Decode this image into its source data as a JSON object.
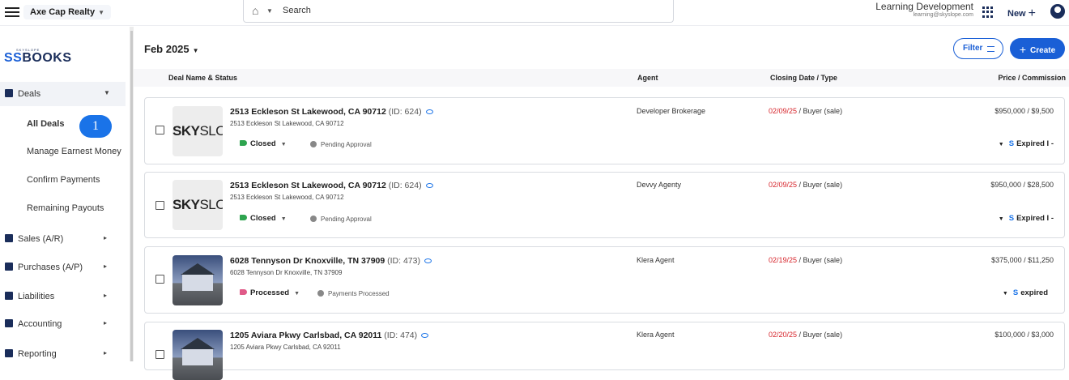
{
  "topbar": {
    "org_name": "Axe Cap Realty",
    "search_placeholder": "Search",
    "user_name": "Learning Development",
    "user_email": "learning@skyslope.com",
    "new_label": "New"
  },
  "sidebar": {
    "logo_small": "SKYSLOPE",
    "logo_text": "BOOKS",
    "deals_label": "Deals",
    "sub_items": [
      "All Deals",
      "Manage Earnest Money",
      "Confirm Payments",
      "Remaining Payouts"
    ],
    "badge": "1",
    "items": [
      "Sales (A/R)",
      "Purchases (A/P)",
      "Liabilities",
      "Accounting",
      "Reporting"
    ]
  },
  "main": {
    "period": "Feb 2025",
    "filter_label": "Filter",
    "create_label": "Create",
    "columns": [
      "Deal Name & Status",
      "Agent",
      "Closing Date / Type",
      "Price / Commission"
    ]
  },
  "deals": [
    {
      "title": "2513 Eckleson St Lakewood, CA 90712",
      "id": "(ID: 624)",
      "address": "2513 Eckleson St Lakewood, CA 90712",
      "thumb_bold": "SKY",
      "thumb_rest": "SLOI",
      "status": "Closed",
      "status_color": "#2ea44f",
      "sub_status": "Pending Approval",
      "agent": "Developer Brokerage",
      "closing_date": "02/09/25",
      "closing_type": " / Buyer (sale)",
      "price": "$950,000 / $9,500",
      "expired": "Expired I -"
    },
    {
      "title": "2513 Eckleson St Lakewood, CA 90712",
      "id": "(ID: 624)",
      "address": "2513 Eckleson St Lakewood, CA 90712",
      "thumb_bold": "SKY",
      "thumb_rest": "SLOI",
      "status": "Closed",
      "status_color": "#2ea44f",
      "sub_status": "Pending Approval",
      "agent": "Devvy Agenty",
      "closing_date": "02/09/25",
      "closing_type": " / Buyer (sale)",
      "price": "$950,000 / $28,500",
      "expired": "Expired I -"
    },
    {
      "title": "6028 Tennyson Dr Knoxville, TN 37909",
      "id": "(ID: 473)",
      "address": "6028 Tennyson Dr Knoxville, TN 37909",
      "status": "Processed",
      "status_color": "#e05a88",
      "sub_status": "Payments Processed",
      "agent": "Klera Agent",
      "closing_date": "02/19/25",
      "closing_type": " / Buyer (sale)",
      "price": "$375,000 / $11,250",
      "expired": "expired"
    },
    {
      "title": "1205 Aviara Pkwy Carlsbad, CA 92011",
      "id": "(ID: 474)",
      "address": "1205 Aviara Pkwy Carlsbad, CA 92011",
      "agent": "Klera Agent",
      "closing_date": "02/20/25",
      "closing_type": " / Buyer (sale)",
      "price": "$100,000 / $3,000"
    }
  ]
}
